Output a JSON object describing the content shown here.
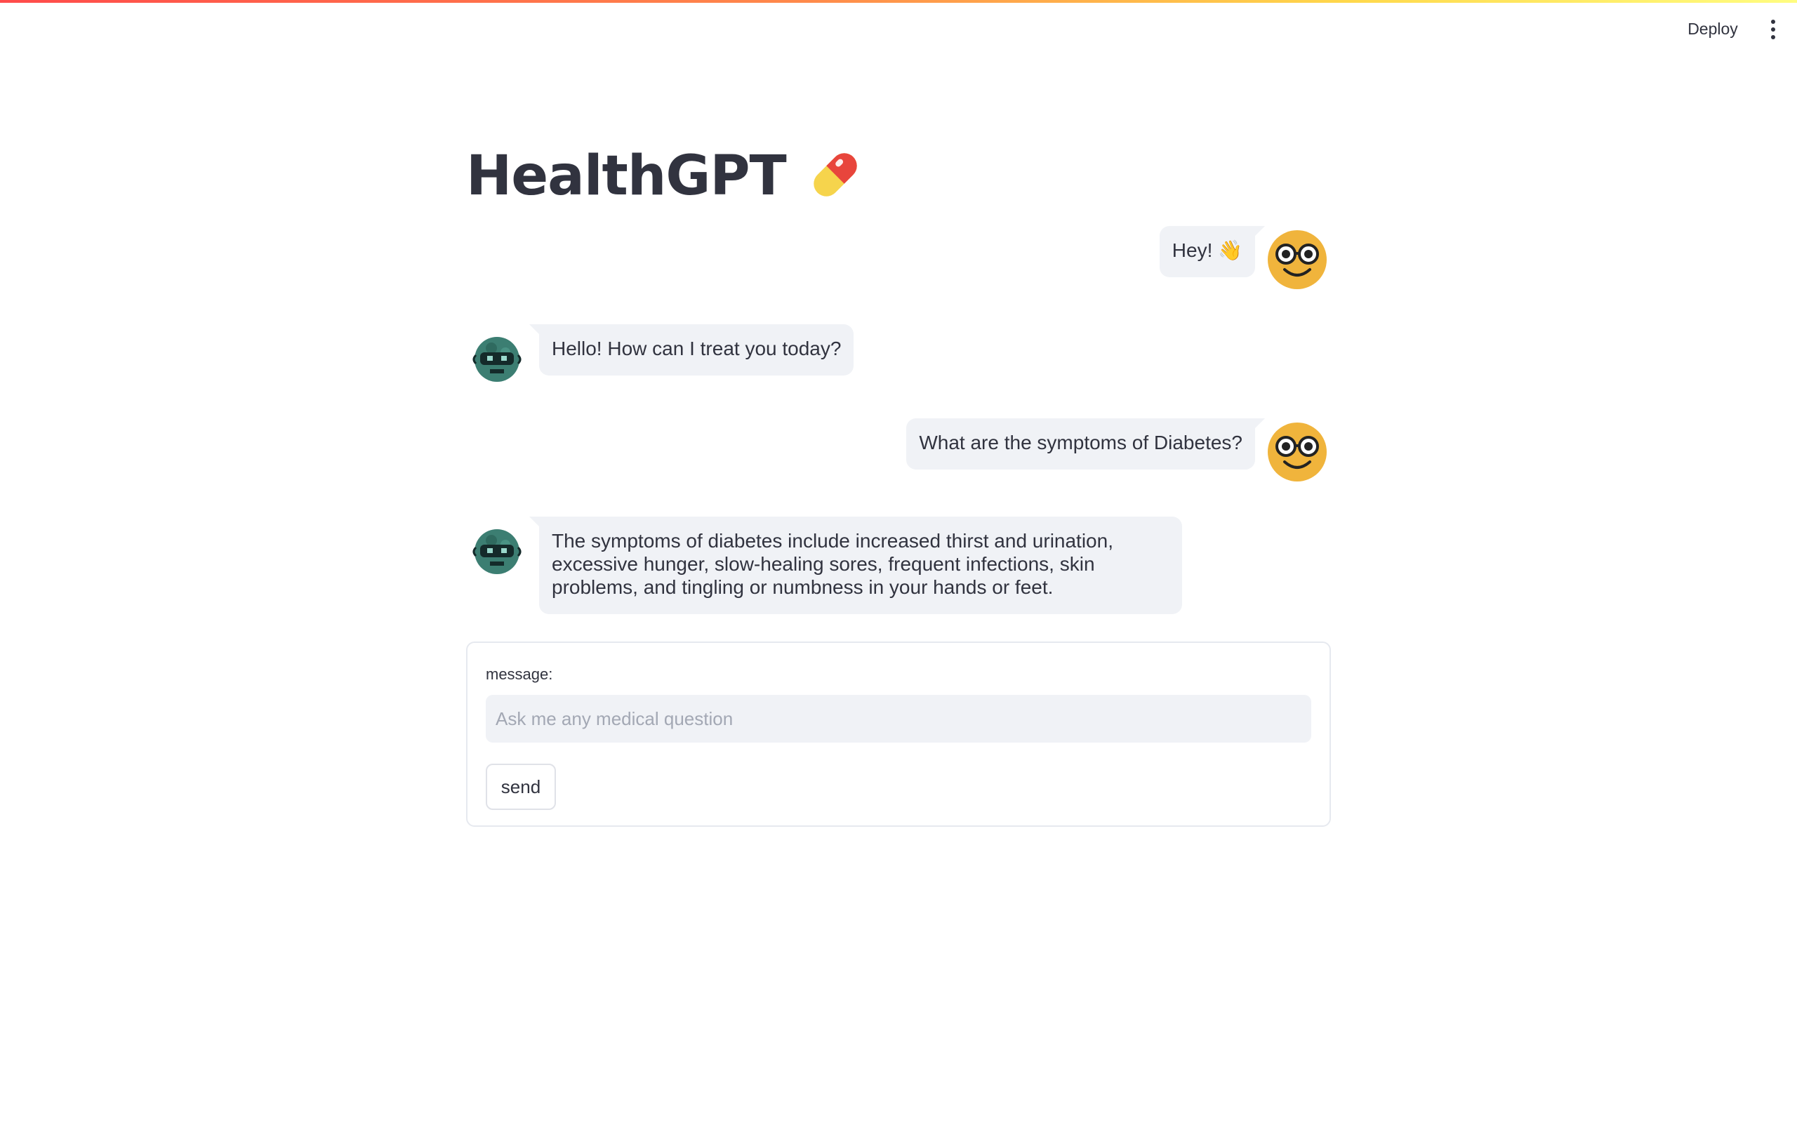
{
  "header": {
    "deploy_label": "Deploy",
    "menu_icon": "kebab-menu-icon"
  },
  "page": {
    "title": "HealthGPT",
    "title_icon": "pill-icon"
  },
  "messages": [
    {
      "role": "user",
      "text": "Hey! 👋",
      "avatar": "nerd-face-icon"
    },
    {
      "role": "bot",
      "text": "Hello! How can I treat you today?",
      "avatar": "robot-icon"
    },
    {
      "role": "user",
      "text": "What are the symptoms of Diabetes?",
      "avatar": "nerd-face-icon"
    },
    {
      "role": "bot",
      "text": "The symptoms of diabetes include increased thirst and urination, excessive hunger, slow-healing sores, frequent infections, skin problems, and tingling or numbness in your hands or feet.",
      "avatar": "robot-icon"
    }
  ],
  "form": {
    "label": "message:",
    "placeholder": "Ask me any medical question",
    "value": "",
    "send_label": "send"
  },
  "colors": {
    "bubble": "#f0f2f6",
    "text": "#31333f",
    "user_avatar": "#f0b43c",
    "bot_avatar": "#3c7e72"
  }
}
